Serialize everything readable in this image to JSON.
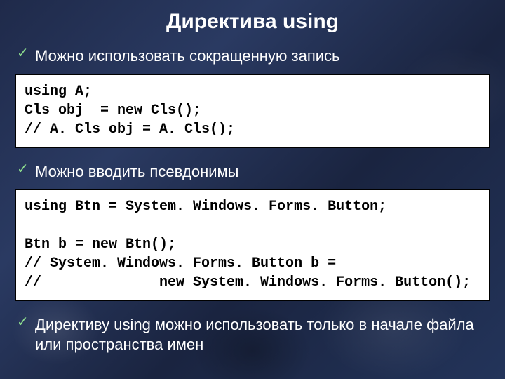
{
  "slide": {
    "title": "Директива using",
    "bullets": {
      "b1": "Можно использовать сокращенную запись",
      "b2": "Можно вводить псевдонимы",
      "b3": "Директиву using можно использовать только в начале файла или пространства имен"
    },
    "code": {
      "block1": "using A;\nCls obj  = new Cls();\n// A. Cls obj = A. Cls();",
      "block2": "using Btn = System. Windows. Forms. Button;\n\nBtn b = new Btn();\n// System. Windows. Forms. Button b =\n//              new System. Windows. Forms. Button();"
    },
    "checkmark": "✓"
  }
}
